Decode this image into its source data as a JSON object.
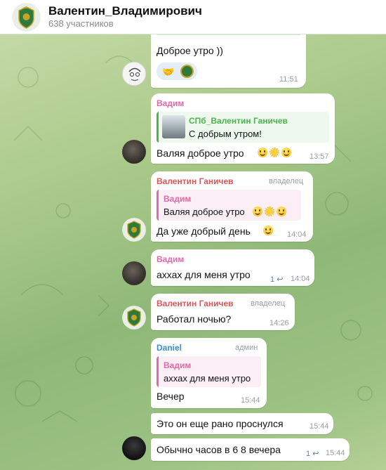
{
  "header": {
    "title": "Валентин_Владимирович",
    "subtitle": "638 участников"
  },
  "messages": [
    {
      "text": "Доброе утро ))",
      "time": "11:51"
    },
    {
      "sender": "Вадим",
      "quote_name": "СПб_Валентин Ганичев",
      "quote_text": "С добрым утром!",
      "text": "Валяя доброе утро",
      "time": "13:57"
    },
    {
      "sender": "Валентин Ганичев",
      "role": "владелец",
      "quote_name": "Вадим",
      "quote_text": "Валяя доброе утро",
      "text": "Да уже добрый день",
      "time": "14:04"
    },
    {
      "sender": "Вадим",
      "text": "аххах для меня утро",
      "replies": "1",
      "time": "14:04"
    },
    {
      "sender": "Валентин Ганичев",
      "role": "владелец",
      "text": "Работал ночью?",
      "time": "14:26"
    },
    {
      "sender": "Daniel",
      "role": "админ",
      "quote_name": "Вадим",
      "quote_text": "аххах для меня утро",
      "text": "Вечер",
      "time": "15:44"
    },
    {
      "text": "Это он еще рано проснулся",
      "time": "15:44"
    },
    {
      "text": "Обычно часов в 6 8 вечера",
      "replies": "1",
      "time": "15:44"
    }
  ],
  "colors": {
    "sender_vadim": "#e36aa5",
    "sender_valentin": "#d9585a",
    "sender_daniel": "#3c8fd3",
    "quote_green": "#4db34d",
    "quote_pink": "#e36aa5",
    "reply_icon": "#5e7f9c"
  },
  "icons": [
    "group-emblem-icon",
    "handshake-icon",
    "reply-arrow-icon",
    "smile-icon",
    "sun-icon"
  ]
}
